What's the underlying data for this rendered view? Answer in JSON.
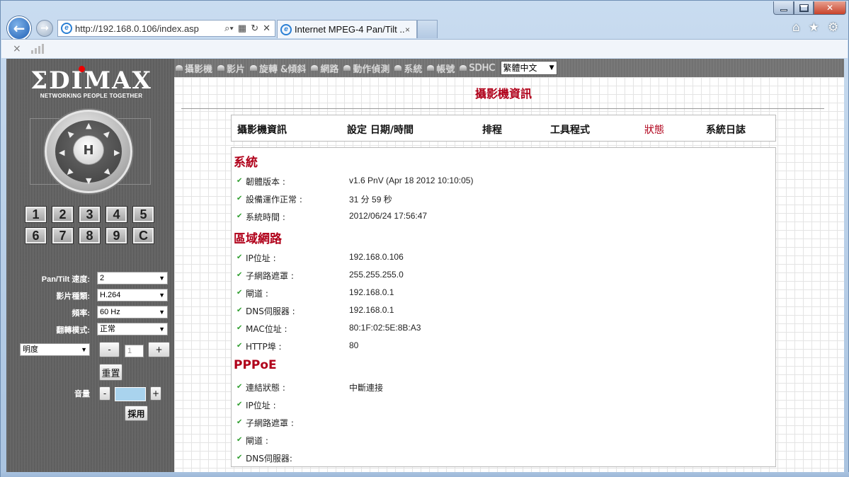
{
  "browser": {
    "address": "http://192.168.0.106/index.asp",
    "tab_title": "Internet MPEG-4 Pan/Tilt ...",
    "tab_close": "×",
    "cmd_close": "×"
  },
  "logo": {
    "main": "ΣDIMAX",
    "tagline": "NETWORKING PEOPLE TOGETHER"
  },
  "ptz": {
    "home": "H"
  },
  "presets": [
    "1",
    "2",
    "3",
    "4",
    "5",
    "6",
    "7",
    "8",
    "9",
    "C"
  ],
  "controls": {
    "pantilt_label": "Pan/Tilt 速度:",
    "pantilt_value": "2",
    "video_label": "影片種類:",
    "video_value": "H.264",
    "freq_label": "頻率:",
    "freq_value": "60 Hz",
    "flip_label": "翻轉模式:",
    "flip_value": "正常",
    "image_select": "明度",
    "minus": "-",
    "plus": "+",
    "image_value": "1",
    "reset": "重置",
    "volume_label": "音量",
    "apply": "採用"
  },
  "menu": {
    "items": [
      "攝影機",
      "影片",
      "旋轉 &傾斜",
      "網路",
      "動作偵測",
      "系統",
      "帳號",
      "SDHC"
    ],
    "language": "繁體中文"
  },
  "page_title": "攝影機資訊",
  "tabs": [
    "攝影機資訊",
    "設定 日期/時間",
    "排程",
    "工具程式",
    "狀態",
    "系統日誌"
  ],
  "active_tab_color": "#b0001a",
  "sections": {
    "system": {
      "title": "系統",
      "rows": [
        {
          "label": "韌體版本 :",
          "value": "v1.6 PnV (Apr 18 2012 10:10:05)"
        },
        {
          "label": "設備運作正常 :",
          "value": "31 分 59 秒"
        },
        {
          "label": "系統時間 :",
          "value": "2012/06/24 17:56:47"
        }
      ]
    },
    "lan": {
      "title": "區域網路",
      "rows": [
        {
          "label": "IP位址 :",
          "value": "192.168.0.106"
        },
        {
          "label": "子網路遮罩 :",
          "value": "255.255.255.0"
        },
        {
          "label": "閘道 :",
          "value": "192.168.0.1"
        },
        {
          "label": "DNS伺服器 :",
          "value": "192.168.0.1"
        },
        {
          "label": "MAC位址 :",
          "value": "80:1F:02:5E:8B:A3"
        },
        {
          "label": "HTTP埠 :",
          "value": "80"
        }
      ]
    },
    "pppoe": {
      "title": "PPPoE",
      "rows": [
        {
          "label": "連結狀態 :",
          "value": "中斷連接"
        },
        {
          "label": "IP位址 :",
          "value": ""
        },
        {
          "label": "子網路遮罩 :",
          "value": ""
        },
        {
          "label": "閘道 :",
          "value": ""
        },
        {
          "label": "DNS伺服器:",
          "value": ""
        }
      ]
    }
  }
}
